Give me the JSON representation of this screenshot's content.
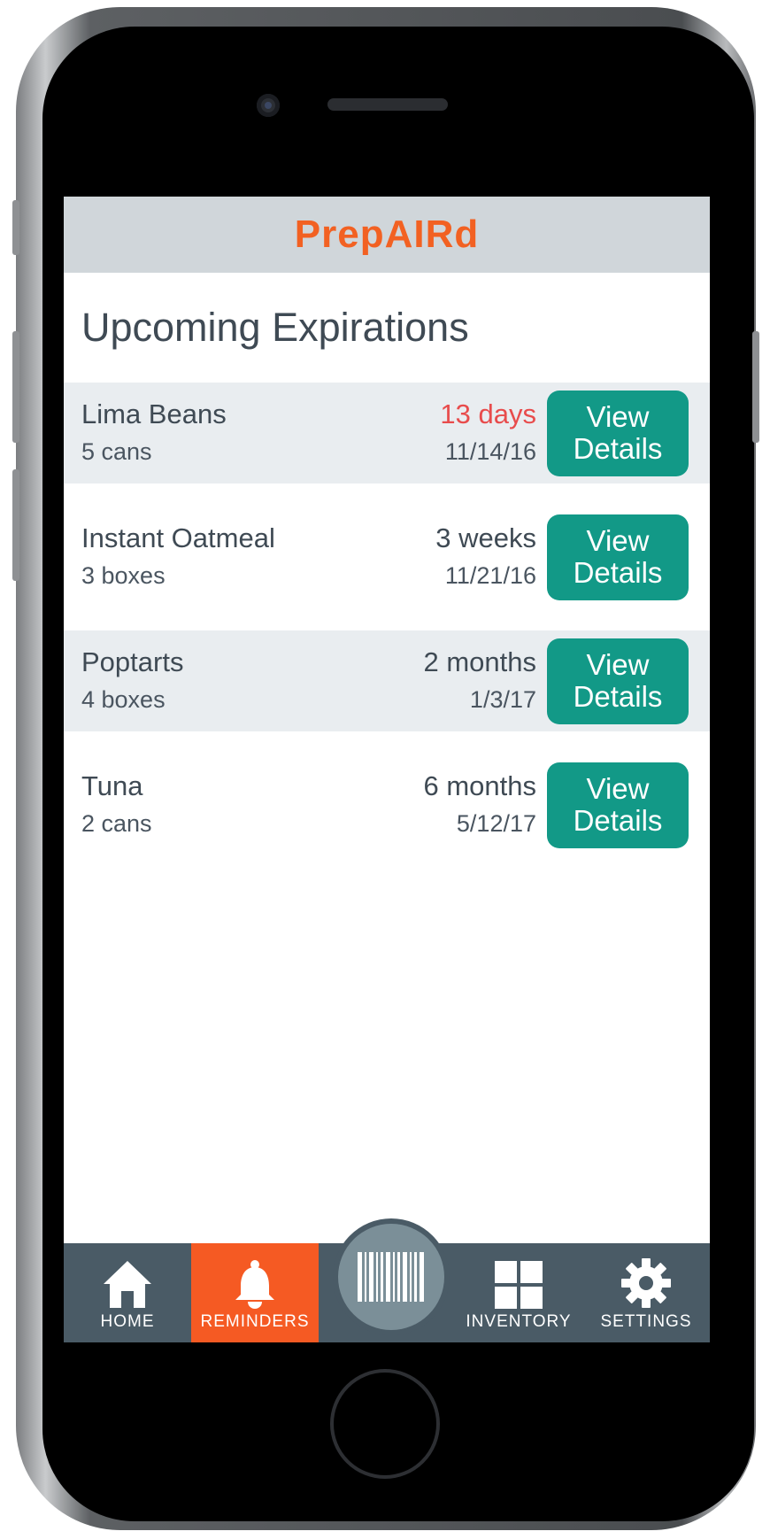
{
  "app": {
    "title": "PrepAIRd"
  },
  "page": {
    "title": "Upcoming Expirations"
  },
  "items": [
    {
      "name": "Lima Beans",
      "quantity": "5 cans",
      "time_left": "13 days",
      "date": "11/14/16",
      "button": [
        "View",
        "Details"
      ],
      "urgent": true
    },
    {
      "name": "Instant Oatmeal",
      "quantity": "3 boxes",
      "time_left": "3 weeks",
      "date": "11/21/16",
      "button": [
        "View",
        "Details"
      ],
      "urgent": false
    },
    {
      "name": "Poptarts",
      "quantity": "4 boxes",
      "time_left": "2 months",
      "date": "1/3/17",
      "button": [
        "View",
        "Details"
      ],
      "urgent": false
    },
    {
      "name": "Tuna",
      "quantity": "2 cans",
      "time_left": "6 months",
      "date": "5/12/17",
      "button": [
        "View",
        "Details"
      ],
      "urgent": false
    }
  ],
  "nav": {
    "home": {
      "label": "HOME",
      "icon": "home-icon"
    },
    "reminders": {
      "label": "REMINDERS",
      "icon": "bell-icon",
      "active": true
    },
    "scan": {
      "icon": "barcode-icon"
    },
    "inventory": {
      "label": "INVENTORY",
      "icon": "grid-icon"
    },
    "settings": {
      "label": "SETTINGS",
      "icon": "gear-icon"
    }
  },
  "colors": {
    "brand": "#f26122",
    "header_bg": "#d0d6da",
    "button": "#129987",
    "urgent": "#e84c4c",
    "nav_bg": "#4a5b66",
    "nav_active": "#f55a23"
  }
}
